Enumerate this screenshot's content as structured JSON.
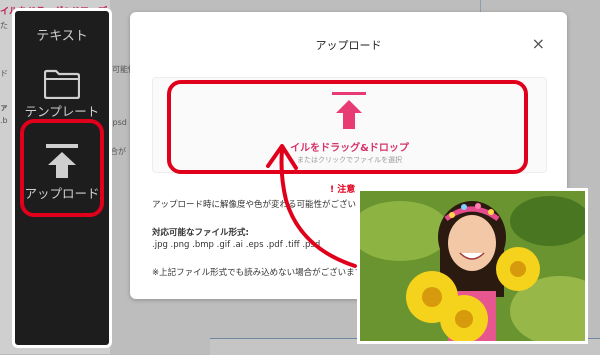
{
  "background": {
    "heading": "イルをドラッグ&ドロップ",
    "line1": "た",
    "line2": "ド",
    "line3": "可能性",
    "line4": "ァ",
    "line5": ".b",
    "line6": ".psd",
    "line7": "合が"
  },
  "sidebar": {
    "text_label": "テキスト",
    "template_label": "テンプレート",
    "upload_label": "アップロード"
  },
  "modal": {
    "title": "アップロード",
    "close": "×",
    "dropzone_title": "イルをドラッグ&ドロップ",
    "dropzone_sub": "またはクリックでファイルを選択",
    "notice": "! 注意",
    "warning": "アップロード時に解像度や色が変わる可能性がございます",
    "formats_heading": "対応可能なファイル形式:",
    "formats_list": ".jpg .png .bmp .gif .ai .eps .pdf .tiff .psd",
    "footnote": "※上記ファイル形式でも読み込めない場合がございます"
  },
  "colors": {
    "accent_pink": "#d6336c",
    "highlight_red": "#e0001b",
    "sidebar_bg": "#1d1d1d"
  },
  "icons": [
    "folder-icon",
    "upload-icon",
    "close-icon",
    "curved-arrow-icon"
  ]
}
